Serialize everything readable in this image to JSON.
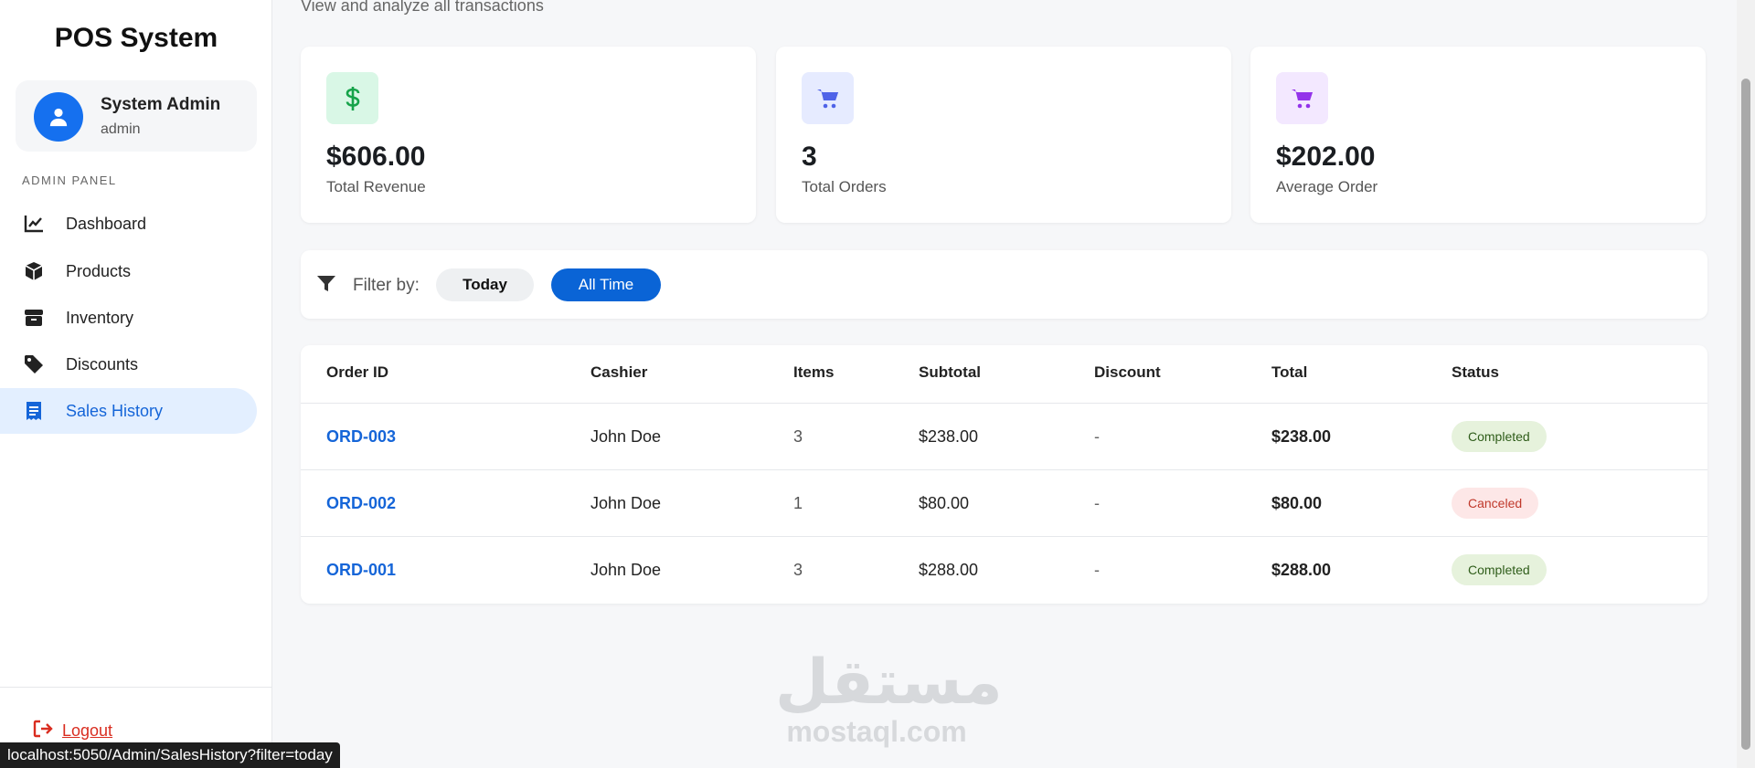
{
  "sidebar": {
    "brand": "POS System",
    "user": {
      "name": "System Admin",
      "role": "admin"
    },
    "section_label": "ADMIN PANEL",
    "items": [
      {
        "label": "Dashboard",
        "icon": "chart-line-icon"
      },
      {
        "label": "Products",
        "icon": "box-icon"
      },
      {
        "label": "Inventory",
        "icon": "archive-icon"
      },
      {
        "label": "Discounts",
        "icon": "tag-icon"
      },
      {
        "label": "Sales History",
        "icon": "receipt-icon",
        "active": true
      }
    ],
    "logout": "Logout"
  },
  "header": {
    "subtitle": "View and analyze all transactions"
  },
  "stats": [
    {
      "value": "$606.00",
      "label": "Total Revenue",
      "icon": "dollar-icon",
      "icon_color": "#16a34a",
      "bg": "#d9f7e6"
    },
    {
      "value": "3",
      "label": "Total Orders",
      "icon": "cart-icon",
      "icon_color": "#4f63e8",
      "bg": "#e6ebff"
    },
    {
      "value": "$202.00",
      "label": "Average Order",
      "icon": "cart-icon",
      "icon_color": "#9333ea",
      "bg": "#f3e8ff"
    }
  ],
  "filter": {
    "label": "Filter by:",
    "today": "Today",
    "all_time": "All Time",
    "active": "All Time"
  },
  "table": {
    "headers": [
      "Order ID",
      "Cashier",
      "Items",
      "Subtotal",
      "Discount",
      "Total",
      "Status"
    ],
    "rows": [
      {
        "order_id": "ORD-003",
        "cashier": "John Doe",
        "items": "3",
        "subtotal": "$238.00",
        "discount": "-",
        "total": "$238.00",
        "status": "Completed"
      },
      {
        "order_id": "ORD-002",
        "cashier": "John Doe",
        "items": "1",
        "subtotal": "$80.00",
        "discount": "-",
        "total": "$80.00",
        "status": "Canceled"
      },
      {
        "order_id": "ORD-001",
        "cashier": "John Doe",
        "items": "3",
        "subtotal": "$288.00",
        "discount": "-",
        "total": "$288.00",
        "status": "Completed"
      }
    ]
  },
  "watermark": {
    "arabic": "مستقل",
    "latin": "mostaql.com"
  },
  "status_url": "localhost:5050/Admin/SalesHistory?filter=today",
  "colors": {
    "accent": "#0a64d6",
    "link": "#1565d8",
    "danger": "#d92d20"
  }
}
